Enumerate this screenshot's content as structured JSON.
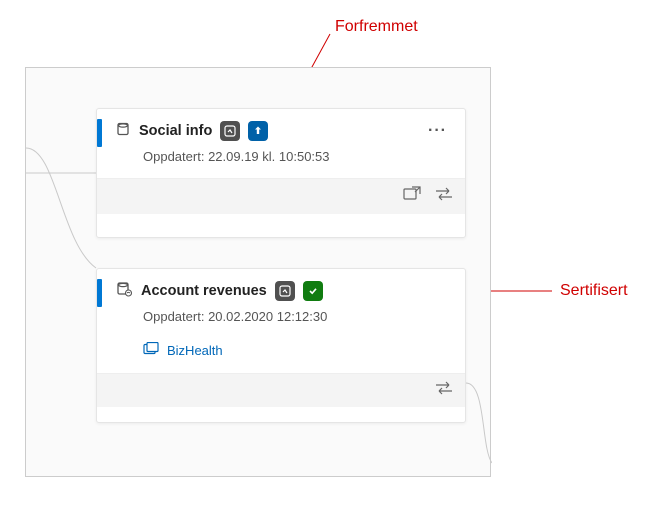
{
  "annotations": {
    "promoted": "Forfremmet",
    "certified": "Sertifisert"
  },
  "cards": [
    {
      "title": "Social info",
      "updated_label": "Oppdatert:",
      "updated_value": "22.09.19 kl. 10:50:53"
    },
    {
      "title": "Account revenues",
      "updated_label": "Oppdatert:",
      "updated_value": "20.02.2020 12:12:30",
      "link_text": "BizHealth"
    }
  ]
}
